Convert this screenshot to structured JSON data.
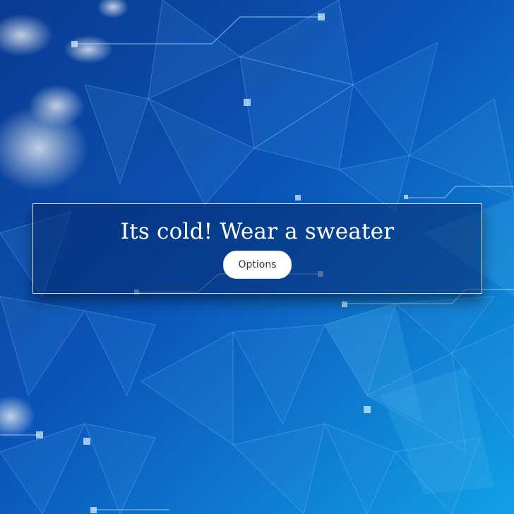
{
  "banner": {
    "headline": "Its cold! Wear a sweater",
    "options_label": "Options"
  },
  "colors": {
    "background_dark": "#0a3e9a",
    "background_light": "#1aa3e8",
    "panel_overlay": "#08286a",
    "button_bg": "#ffffff",
    "button_text": "#333333",
    "headline_text": "#ffffff"
  }
}
